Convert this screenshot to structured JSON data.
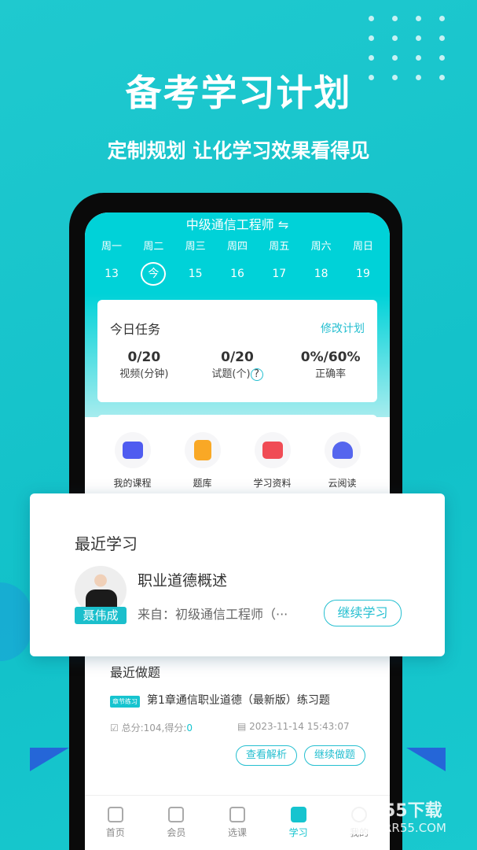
{
  "banner": {
    "title": "备考学习计划",
    "subtitle": "定制规划 让化学习效果看得见"
  },
  "header": {
    "course": "中级通信工程师 ⇋"
  },
  "week": [
    {
      "d": "周一",
      "n": "13"
    },
    {
      "d": "周二",
      "n": "今",
      "today": true
    },
    {
      "d": "周三",
      "n": "15"
    },
    {
      "d": "周四",
      "n": "16"
    },
    {
      "d": "周五",
      "n": "17"
    },
    {
      "d": "周六",
      "n": "18"
    },
    {
      "d": "周日",
      "n": "19"
    }
  ],
  "task": {
    "title": "今日任务",
    "edit": "修改计划",
    "stats": [
      {
        "value": "0/20",
        "label": "视频(分钟)"
      },
      {
        "value": "0/20",
        "label": "试题(个)"
      },
      {
        "value": "0%/60%",
        "label": "正确率"
      }
    ],
    "help": "?"
  },
  "tools": [
    {
      "label": "我的课程",
      "color": "#4f5cf0"
    },
    {
      "label": "题库",
      "color": "#f9a825"
    },
    {
      "label": "学习资料",
      "color": "#f04c55"
    },
    {
      "label": "云阅读",
      "color": "#5566ee"
    }
  ],
  "recent": {
    "title": "最近学习",
    "teacher": "聂伟成",
    "lesson": "职业道德概述",
    "from": "来自：初级通信工程师（···",
    "button": "继续学习"
  },
  "quiz": {
    "title": "最近做题",
    "tag": "章节练习",
    "name": "第1章通信职业道德（最新版）练习题",
    "score_label": "总分:104,得分:",
    "score": "0",
    "time": "2023-11-14 15:43:07",
    "review": "查看解析",
    "continue": "继续做题"
  },
  "nav": [
    {
      "label": "首页"
    },
    {
      "label": "会员"
    },
    {
      "label": "选课"
    },
    {
      "label": "学习",
      "active": true
    },
    {
      "label": "我的"
    }
  ],
  "watermark": {
    "text": "55下载",
    "url": "RR55.COM"
  },
  "colors": {
    "accent": "#16c4cf",
    "background": "#13c3cb"
  }
}
